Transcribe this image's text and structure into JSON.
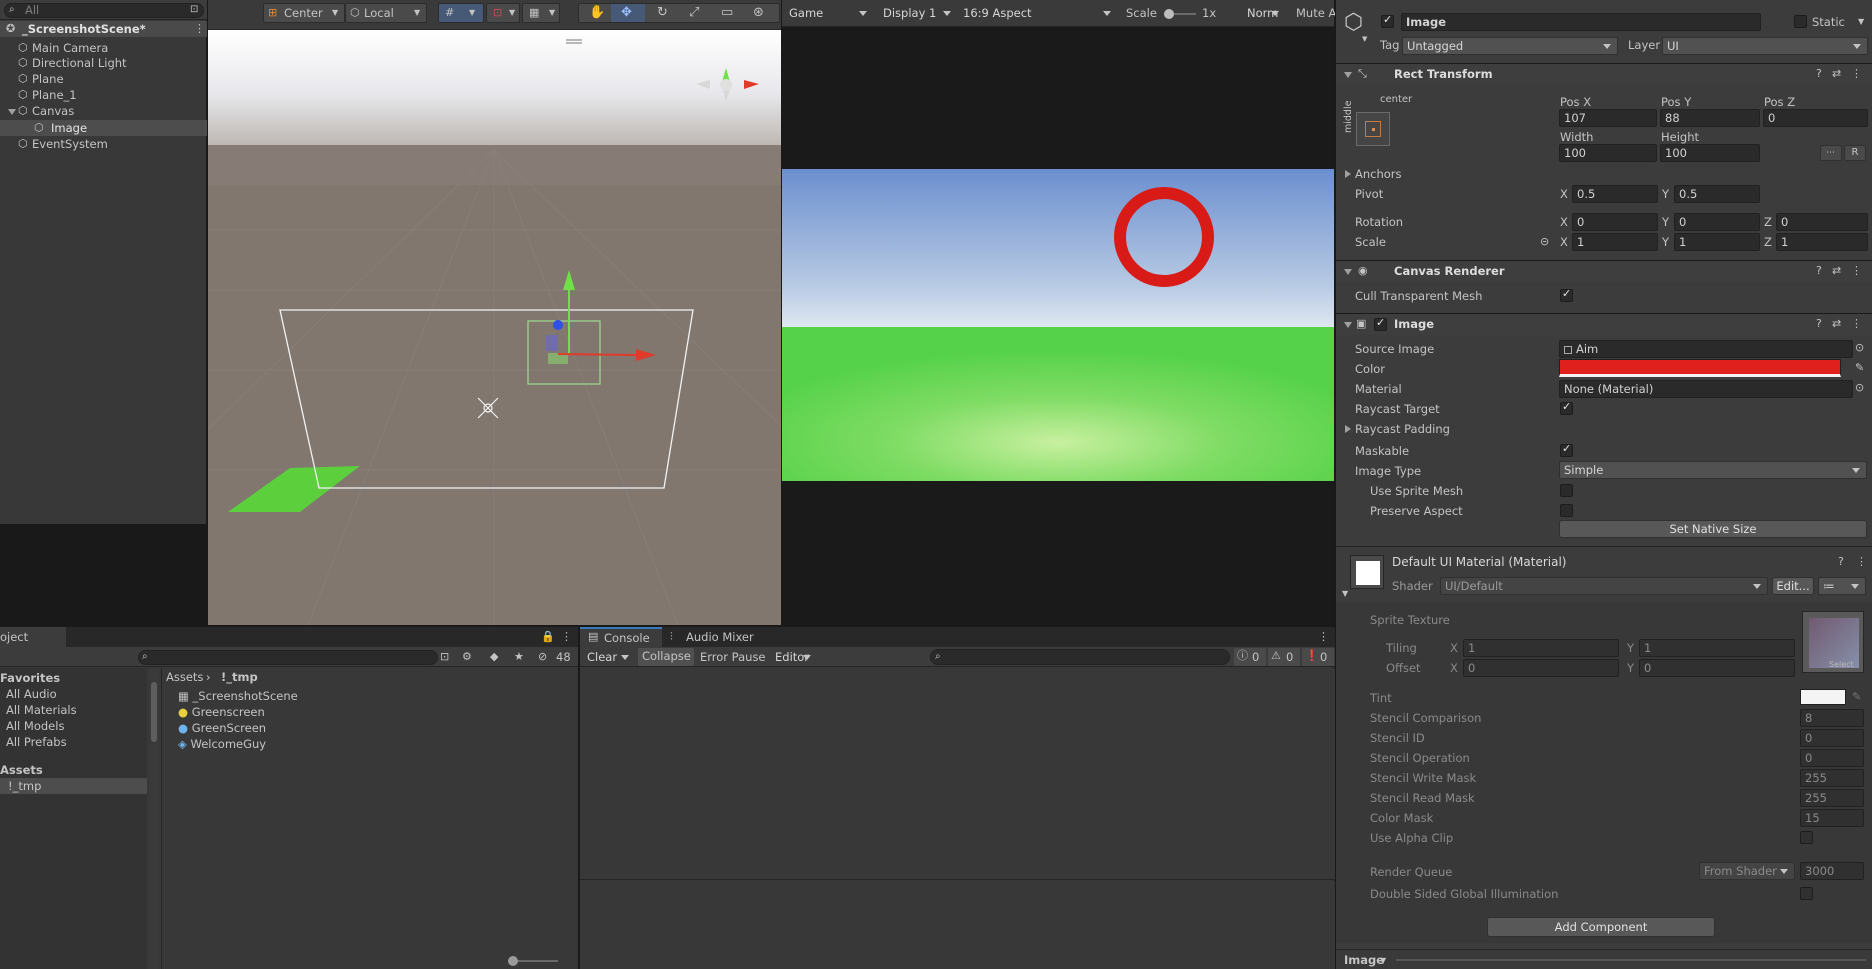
{
  "hierarchy": {
    "search_placeholder": "All",
    "scene": "_ScreenshotScene*",
    "items": [
      "Main Camera",
      "Directional Light",
      "Plane",
      "Plane_1",
      "Canvas",
      "Image",
      "EventSystem"
    ]
  },
  "scene_toolbar": {
    "pivot": "Center",
    "space": "Local"
  },
  "game_toolbar": {
    "tab": "Game",
    "display": "Display 1",
    "aspect": "16:9 Aspect",
    "scale_label": "Scale",
    "scale_value": "1x",
    "play_mode": "Norm",
    "mute": "Mute A"
  },
  "project": {
    "tab": "oject",
    "favorites_title": "Favorites",
    "favorites": [
      "All Audio",
      "All Materials",
      "All Models",
      "All Prefabs"
    ],
    "assets_title": "Assets",
    "assets_folders": [
      "!_tmp"
    ],
    "breadcrumb": [
      "Assets",
      "!_tmp"
    ],
    "files": [
      "_ScreenshotScene",
      "Greenscreen",
      "GreenScreen",
      "WelcomeGuy"
    ],
    "hidden_count": "48"
  },
  "console": {
    "tab": "Console",
    "tab2": "Audio Mixer",
    "clear": "Clear",
    "collapse": "Collapse",
    "error_pause": "Error Pause",
    "editor": "Editor",
    "count_log": "0",
    "count_warn": "0",
    "count_err": "0"
  },
  "inspector": {
    "object_name": "Image",
    "static": "Static",
    "tag_label": "Tag",
    "tag": "Untagged",
    "layer_label": "Layer",
    "layer": "UI",
    "rect": {
      "title": "Rect Transform",
      "anchor_h": "center",
      "anchor_v": "middle",
      "posx_label": "Pos X",
      "posy_label": "Pos Y",
      "posz_label": "Pos Z",
      "posx": "107",
      "posy": "88",
      "posz": "0",
      "width_label": "Width",
      "height_label": "Height",
      "width": "100",
      "height": "100",
      "r_btn": "R",
      "anchors": "Anchors",
      "pivot": "Pivot",
      "pivot_x": "0.5",
      "pivot_y": "0.5",
      "rotation": "Rotation",
      "rot_x": "0",
      "rot_y": "0",
      "rot_z": "0",
      "scale": "Scale",
      "scale_x": "1",
      "scale_y": "1",
      "scale_z": "1",
      "x": "X",
      "y": "Y",
      "z": "Z"
    },
    "canvas_renderer": {
      "title": "Canvas Renderer",
      "cull": "Cull Transparent Mesh"
    },
    "image": {
      "title": "Image",
      "source_label": "Source Image",
      "source": "Aim",
      "color_label": "Color",
      "color": "#e0201c",
      "material_label": "Material",
      "material": "None (Material)",
      "raycast": "Raycast Target",
      "raycast_padding": "Raycast Padding",
      "maskable": "Maskable",
      "type_label": "Image Type",
      "type": "Simple",
      "use_sprite_mesh": "Use Sprite Mesh",
      "preserve": "Preserve Aspect",
      "native_btn": "Set Native Size"
    },
    "material": {
      "title": "Default UI Material (Material)",
      "shader_label": "Shader",
      "shader": "UI/Default",
      "edit": "Edit...",
      "sprite_texture": "Sprite Texture",
      "tiling": "Tiling",
      "offset": "Offset",
      "tiling_x": "1",
      "tiling_y": "1",
      "offset_x": "0",
      "offset_y": "0",
      "tint": "Tint",
      "stencil_comp": "Stencil Comparison",
      "stencil_comp_v": "8",
      "stencil_id": "Stencil ID",
      "stencil_id_v": "0",
      "stencil_op": "Stencil Operation",
      "stencil_op_v": "0",
      "stencil_write": "Stencil Write Mask",
      "stencil_write_v": "255",
      "stencil_read": "Stencil Read Mask",
      "stencil_read_v": "255",
      "color_mask": "Color Mask",
      "color_mask_v": "15",
      "alpha_clip": "Use Alpha Clip",
      "render_queue": "Render Queue",
      "render_queue_mode": "From Shader",
      "render_queue_v": "3000",
      "double_sided": "Double Sided Global Illumination",
      "select_label": "Select"
    },
    "add_component": "Add Component",
    "footer": "Image"
  },
  "colors": {
    "game_sky_top": "#6e93d0",
    "game_ground": "#55d44a",
    "aim": "#d81b17"
  }
}
